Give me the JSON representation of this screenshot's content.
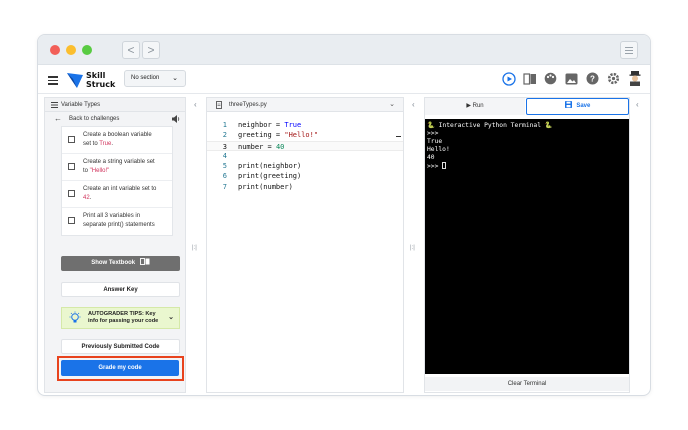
{
  "browser": {
    "nav_back": "<",
    "nav_forward": ">"
  },
  "appbar": {
    "logo_line1": "Skill",
    "logo_line2": "Struck",
    "section_select": "No section",
    "icons": [
      "run-circle-icon",
      "book-icon",
      "palette-icon",
      "image-icon",
      "help-icon",
      "settings-icon",
      "avatar"
    ]
  },
  "left": {
    "header": "Variable Types",
    "back": "Back to challenges",
    "checklist": [
      {
        "line1": "Create a boolean variable",
        "line2_pre": "set to ",
        "line2_code": "True",
        "line2_post": "."
      },
      {
        "line1": "Create a string variable set",
        "line2_pre": "to ",
        "line2_code": "\"Hello!\"",
        "line2_post": ""
      },
      {
        "line1": "Create an int variable set to",
        "line2_pre": "",
        "line2_code": "42",
        "line2_post": "."
      },
      {
        "line1": "Print all 3 variables in",
        "line2_pre": "separate print() statements",
        "line2_code": "",
        "line2_post": ""
      }
    ],
    "show_textbook": "Show Textbook",
    "answer_key": "Answer Key",
    "tips_line1": "AUTOGRADER TIPS: Key",
    "tips_line2": "info for passing your code",
    "previous": "Previously Submitted Code",
    "grade": "Grade my code"
  },
  "editor": {
    "filename": "threeTypes.py",
    "lines": [
      {
        "n": "1",
        "a": "neighbor = ",
        "b": "True",
        "c": ""
      },
      {
        "n": "2",
        "a": "greeting = ",
        "b": "\"Hello!\"",
        "c": ""
      },
      {
        "n": "3",
        "a": "number = ",
        "b": "40",
        "c": ""
      },
      {
        "n": "4",
        "a": "",
        "b": "",
        "c": ""
      },
      {
        "n": "5",
        "a": "print(neighbor)",
        "b": "",
        "c": ""
      },
      {
        "n": "6",
        "a": "print(greeting)",
        "b": "",
        "c": ""
      },
      {
        "n": "7",
        "a": "print(number)",
        "b": "",
        "c": ""
      }
    ]
  },
  "terminal": {
    "run": "Run",
    "save": "Save",
    "output": "🐍 Interactive Python Terminal 🐍\n>>>\nTrue\nHello!\n40\n>>> ",
    "clear": "Clear Terminal"
  },
  "handles": {
    "left": "|:|",
    "right": "|:|"
  },
  "colors": {
    "accent": "#1a73e8",
    "highlight_border": "#e8431d",
    "tips_bg": "#eaf7cf",
    "code_string": "#a31515",
    "code_keyword": "#0000ff",
    "code_number": "#098658"
  }
}
